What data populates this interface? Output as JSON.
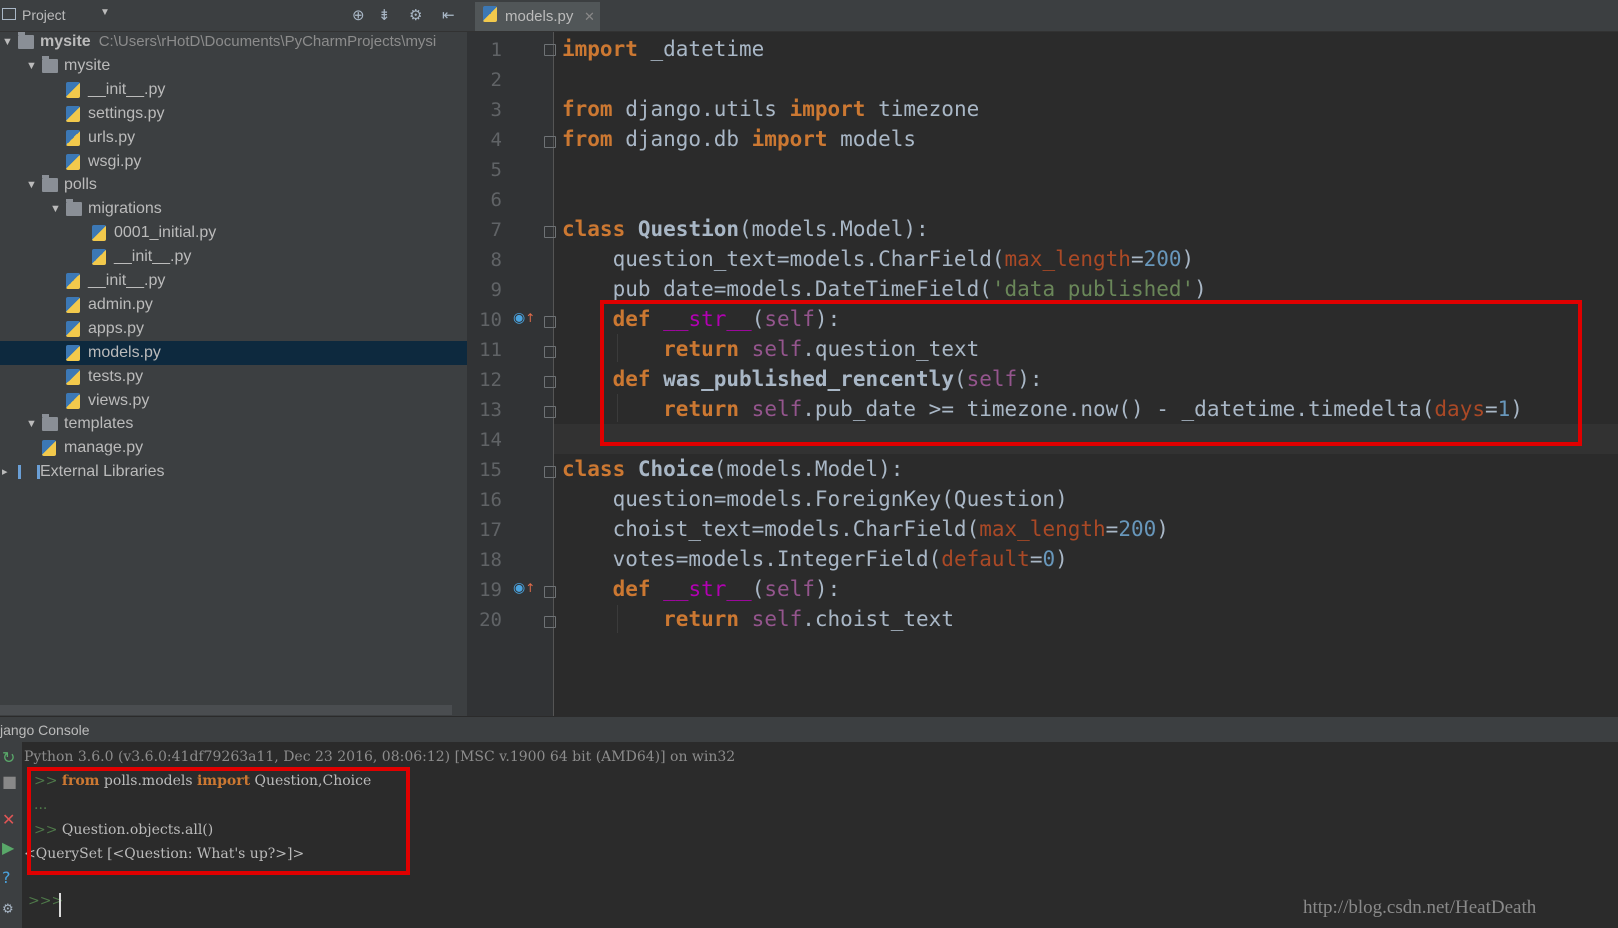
{
  "project_panel": {
    "title": "Project",
    "tree": [
      {
        "label": "mysite",
        "path": "C:\\Users\\rHotD\\Documents\\PyCharmProjects\\mysi",
        "type": "folder",
        "depth": 0
      },
      {
        "label": "mysite",
        "type": "folder",
        "depth": 1
      },
      {
        "label": "__init__.py",
        "type": "py",
        "depth": 2
      },
      {
        "label": "settings.py",
        "type": "py",
        "depth": 2
      },
      {
        "label": "urls.py",
        "type": "py",
        "depth": 2
      },
      {
        "label": "wsgi.py",
        "type": "py",
        "depth": 2
      },
      {
        "label": "polls",
        "type": "folder",
        "depth": 1
      },
      {
        "label": "migrations",
        "type": "folder",
        "depth": 2
      },
      {
        "label": "0001_initial.py",
        "type": "py",
        "depth": 3
      },
      {
        "label": "__init__.py",
        "type": "py",
        "depth": 3
      },
      {
        "label": "__init__.py",
        "type": "py",
        "depth": 2
      },
      {
        "label": "admin.py",
        "type": "py",
        "depth": 2
      },
      {
        "label": "apps.py",
        "type": "py",
        "depth": 2
      },
      {
        "label": "models.py",
        "type": "py",
        "depth": 2,
        "selected": true
      },
      {
        "label": "tests.py",
        "type": "py",
        "depth": 2
      },
      {
        "label": "views.py",
        "type": "py",
        "depth": 2
      },
      {
        "label": "templates",
        "type": "folder",
        "depth": 1
      },
      {
        "label": "manage.py",
        "type": "py",
        "depth": 1
      },
      {
        "label": "External Libraries",
        "type": "lib",
        "depth": 0
      }
    ]
  },
  "editor": {
    "tab_label": "models.py",
    "line_numbers": [
      "1",
      "2",
      "3",
      "4",
      "5",
      "6",
      "7",
      "8",
      "9",
      "10",
      "11",
      "12",
      "13",
      "14",
      "15",
      "16",
      "17",
      "18",
      "19",
      "20"
    ]
  },
  "console": {
    "title": "jango Console",
    "lines": [
      "Python 3.6.0 (v3.6.0:41df79263a11, Dec 23 2016, 08:06:12) [MSC v.1900 64 bit (AMD64)] on win32",
      ">>> from polls.models import Question,Choice",
      "...",
      ">>> Question.objects.all()",
      "<QuerySet [<Question: What's up?>]>",
      ">>>"
    ]
  },
  "watermark": "http://blog.csdn.net/HeatDeath",
  "colors": {
    "highlight": "#e00000",
    "keyword": "#cc7832",
    "self": "#94558d",
    "param": "#aa4926",
    "number": "#6897bb"
  }
}
